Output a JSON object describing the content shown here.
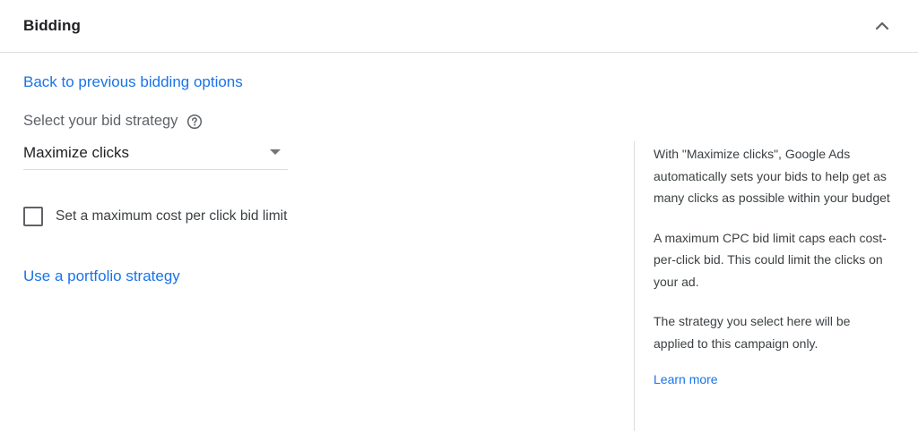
{
  "header": {
    "title": "Bidding",
    "collapse_icon": "chevron-up-icon"
  },
  "main": {
    "back_link": "Back to previous bidding options",
    "strategy_label": "Select your bid strategy",
    "help_icon": "help-circle-icon",
    "strategy_select": {
      "selected": "Maximize clicks",
      "arrow_icon": "dropdown-arrow-icon"
    },
    "max_cpc_checkbox": {
      "label": "Set a maximum cost per click bid limit",
      "checked": false
    },
    "portfolio_link": "Use a portfolio strategy"
  },
  "side_panel": {
    "paragraph1": "With \"Maximize clicks\", Google Ads automatically sets your bids to help get as many clicks as possible within your budget",
    "paragraph2": "A maximum CPC bid limit caps each cost-per-click bid. This could limit the clicks on your ad.",
    "paragraph3": "The strategy you select here will be applied to this campaign only.",
    "learn_more": "Learn more"
  },
  "colors": {
    "link": "#1a73e8",
    "text": "#3c4043",
    "divider": "#e0e0e0"
  }
}
